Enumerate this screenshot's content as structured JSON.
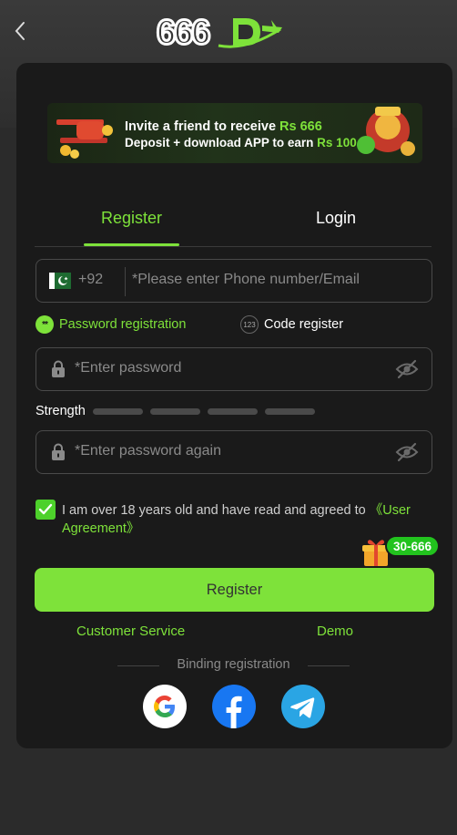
{
  "header": {
    "back_icon": "chevron-left-icon",
    "logo_text": "666D"
  },
  "banner": {
    "line1_prefix": "Invite a friend to receive",
    "line1_amount": "Rs 666",
    "line2_prefix": "Deposit + download APP to earn",
    "line2_amount": "Rs 100"
  },
  "tabs": {
    "register": "Register",
    "login": "Login",
    "active": "register"
  },
  "phone": {
    "country_code": "+92",
    "required_mark": "*",
    "placeholder": "Please enter Phone number/Email",
    "flag_icon": "pakistan-flag-icon"
  },
  "modes": {
    "password_icon_text": "**",
    "password_label": "Password registration",
    "code_icon_text": "123",
    "code_label": "Code register"
  },
  "password": {
    "required_mark": "*",
    "placeholder": "Enter password"
  },
  "strength": {
    "label": "Strength",
    "level": 0,
    "segments": 4
  },
  "password_again": {
    "required_mark": "*",
    "placeholder": "Enter password again"
  },
  "agreement": {
    "checked": true,
    "text": "I am over 18 years old and have read and agreed to",
    "link": "《User Agreement》"
  },
  "promo": {
    "badge": "30-666",
    "icon": "gift-icon"
  },
  "buttons": {
    "register": "Register",
    "customer_service": "Customer Service",
    "demo": "Demo"
  },
  "binding": {
    "label": "Binding registration",
    "providers": [
      "google-icon",
      "facebook-icon",
      "telegram-icon"
    ]
  },
  "colors": {
    "accent": "#7ee23a",
    "background": "#2b2b2b",
    "card": "#1a1a1a",
    "required": "#e0483a"
  }
}
